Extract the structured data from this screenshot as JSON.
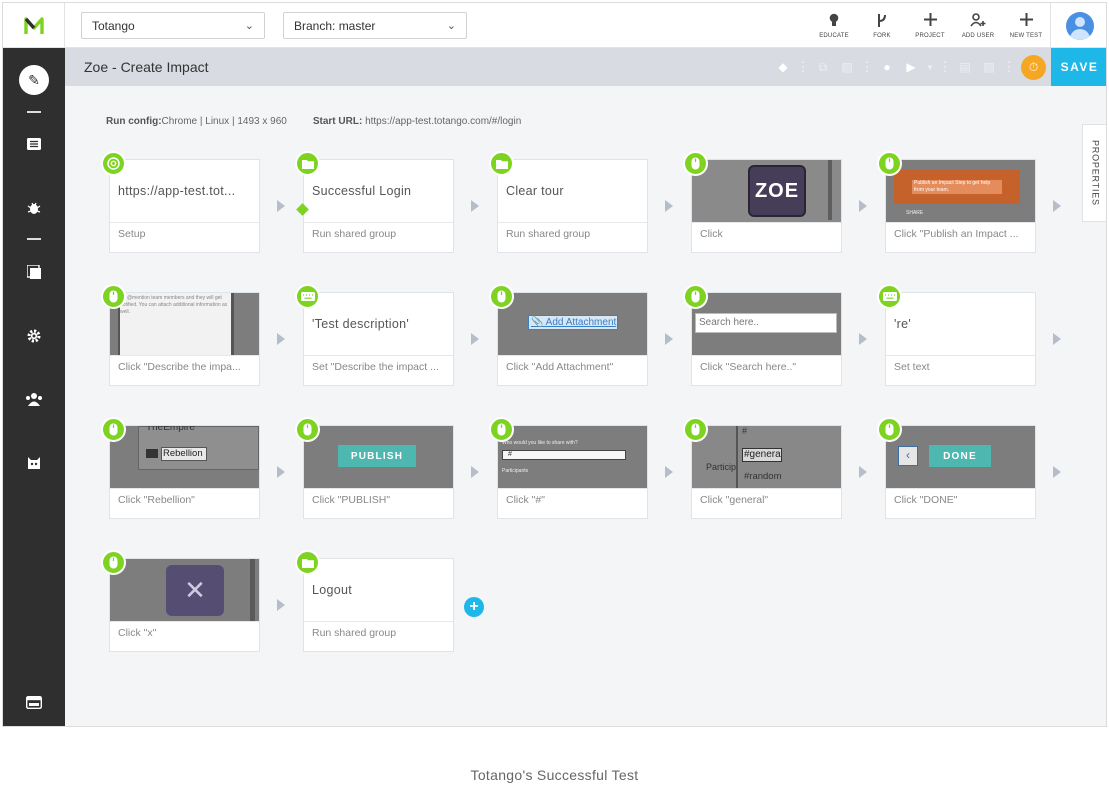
{
  "app": {
    "logo": "M",
    "logo_color": "#7ed321"
  },
  "topbar": {
    "project_select": "Totango",
    "branch_select": "Branch: master",
    "actions": [
      {
        "label": "EDUCATE",
        "icon": "lightbulb-icon",
        "glyph": "💡"
      },
      {
        "label": "FORK",
        "icon": "fork-icon",
        "glyph": "ⴼ"
      },
      {
        "label": "PROJECT",
        "icon": "plus-icon",
        "glyph": "+"
      },
      {
        "label": "ADD USER",
        "icon": "add-user-icon",
        "glyph": "👤"
      },
      {
        "label": "NEW TEST",
        "icon": "plus-icon",
        "glyph": "+"
      }
    ]
  },
  "titlebar": {
    "title": "Zoe - Create Impact",
    "save_label": "SAVE"
  },
  "run_config": {
    "config_label": "Run config:",
    "config_value": "Chrome | Linux | 1493 x 960",
    "url_label": "Start URL:",
    "url_value": "https://app-test.totango.com/#/login"
  },
  "properties_label": "PROPERTIES",
  "steps": [
    {
      "kind": "text",
      "icon": "chrome",
      "title": "https://app-test.tot...",
      "caption": "Setup"
    },
    {
      "kind": "text",
      "icon": "folder",
      "title": "Successful Login",
      "caption": "Run shared group"
    },
    {
      "kind": "text",
      "icon": "folder",
      "title": "Clear tour",
      "caption": "Run shared group"
    },
    {
      "kind": "shot",
      "icon": "mouse",
      "shot_text": "ZOE",
      "caption": "Click"
    },
    {
      "kind": "shot",
      "icon": "mouse",
      "shot_text": "Publish an Impact Step to get help from your team.",
      "caption": "Click \"Publish an Impact ..."
    },
    {
      "kind": "shot",
      "icon": "mouse",
      "shot_text": "an @mention team members and they will get notified. You can attach additional information as well.",
      "caption": "Click \"Describe the impa..."
    },
    {
      "kind": "text",
      "icon": "keyboard",
      "title": "'Test description'",
      "caption": "Set \"Describe the impact ..."
    },
    {
      "kind": "shot",
      "icon": "mouse",
      "shot_text": "📎 Add Attachment",
      "caption": "Click \"Add Attachment\""
    },
    {
      "kind": "shot",
      "icon": "mouse",
      "shot_text": "Search here..",
      "caption": "Click \"Search here..\""
    },
    {
      "kind": "text",
      "icon": "keyboard",
      "title": "'re'",
      "caption": "Set text"
    },
    {
      "kind": "shot",
      "icon": "mouse",
      "shot_text": "Rebellion",
      "caption": "Click \"Rebellion\""
    },
    {
      "kind": "shot",
      "icon": "mouse",
      "shot_text": "PUBLISH",
      "caption": "Click \"PUBLISH\""
    },
    {
      "kind": "shot",
      "icon": "mouse",
      "shot_text": "#",
      "caption": "Click \"#\""
    },
    {
      "kind": "shot",
      "icon": "mouse",
      "shot_text": "#genera",
      "caption": "Click \"general\""
    },
    {
      "kind": "shot",
      "icon": "mouse",
      "shot_text": "DONE",
      "caption": "Click \"DONE\""
    },
    {
      "kind": "shot",
      "icon": "mouse",
      "shot_text": "✕",
      "caption": "Click \"x\""
    },
    {
      "kind": "text",
      "icon": "folder",
      "title": "Logout",
      "caption": "Run shared group"
    }
  ],
  "caption": "Totango's Successful Test",
  "colors": {
    "accent": "#1db7e8",
    "badge": "#7ed321",
    "timer": "#f5a623",
    "sidebar": "#2f2f2f"
  }
}
